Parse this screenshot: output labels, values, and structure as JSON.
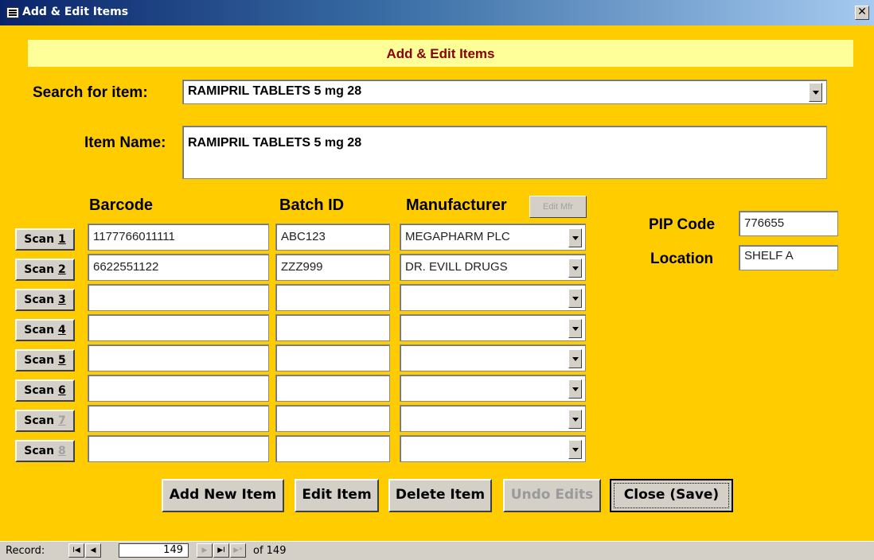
{
  "window": {
    "title": "Add & Edit Items",
    "close_glyph": "✕"
  },
  "form": {
    "header": "Add & Edit Items",
    "search_label": "Search for item:",
    "search_value": "RAMIPRIL  TABLETS 5 mg 28",
    "item_name_label": "Item Name:",
    "item_name_value": "RAMIPRIL  TABLETS 5 mg 28",
    "columns": {
      "barcode": "Barcode",
      "batch": "Batch ID",
      "manufacturer": "Manufacturer"
    },
    "edit_mfr_label": "Edit Mfr",
    "pip_label": "PIP Code",
    "pip_value": "776655",
    "location_label": "Location",
    "location_value": "SHELF A"
  },
  "rows": [
    {
      "scan": "Scan",
      "num": "1",
      "barcode": "1177766011111",
      "batch": "ABC123",
      "manufacturer": "MEGAPHARM PLC"
    },
    {
      "scan": "Scan",
      "num": "2",
      "barcode": "6622551122",
      "batch": "ZZZ999",
      "manufacturer": "DR. EVILL DRUGS"
    },
    {
      "scan": "Scan",
      "num": "3",
      "barcode": "",
      "batch": "",
      "manufacturer": ""
    },
    {
      "scan": "Scan",
      "num": "4",
      "barcode": "",
      "batch": "",
      "manufacturer": ""
    },
    {
      "scan": "Scan",
      "num": "5",
      "barcode": "",
      "batch": "",
      "manufacturer": ""
    },
    {
      "scan": "Scan",
      "num": "6",
      "barcode": "",
      "batch": "",
      "manufacturer": ""
    },
    {
      "scan": "Scan",
      "num": "7",
      "barcode": "",
      "batch": "",
      "manufacturer": ""
    },
    {
      "scan": "Scan",
      "num": "8",
      "barcode": "",
      "batch": "",
      "manufacturer": ""
    }
  ],
  "buttons": {
    "add_new": "Add New Item",
    "edit": "Edit Item",
    "delete": "Delete Item",
    "undo": "Undo Edits",
    "close": "Close (Save)"
  },
  "status": {
    "record_label": "Record:",
    "current": "149",
    "of_text": "of  149",
    "nav_first": "I◀",
    "nav_prev": "◀",
    "nav_next": "▶",
    "nav_last": "▶I",
    "nav_new": "▶*"
  },
  "colors": {
    "form_bg": "#ffcc00",
    "header_band": "#ffff99",
    "header_text": "#8b0000"
  }
}
